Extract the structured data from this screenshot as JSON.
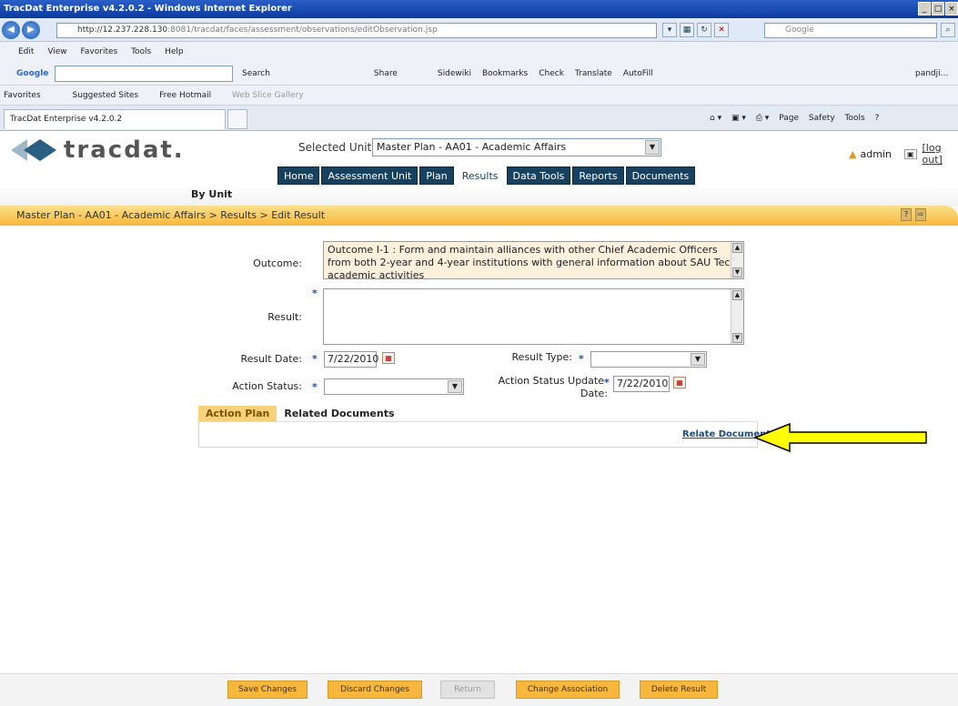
{
  "browser": {
    "title": "TracDat Enterprise v4.2.0.2 - Windows Internet Explorer",
    "url_host": "http://12.237.228.130",
    "url_path": ":8081/tracdat/faces/assessment/observations/editObservation.jsp",
    "search_placeholder": "Google",
    "menu": [
      "Edit",
      "View",
      "Favorites",
      "Tools",
      "Help"
    ],
    "google_label": "Google",
    "toolbar_items": [
      "Search",
      "Share",
      "Sidewiki",
      "Bookmarks",
      "Check",
      "Translate",
      "AutoFill",
      "pandji..."
    ],
    "favorites_label": "Favorites",
    "fav_items": [
      "Suggested Sites",
      "Free Hotmail",
      "Web Slice Gallery"
    ],
    "tab_title": "TracDat Enterprise v4.2.0.2",
    "commands": [
      "Page",
      "Safety",
      "Tools"
    ]
  },
  "app": {
    "logo_text": "tracdat.",
    "selected_unit_label": "Selected Unit:",
    "selected_unit_value": "Master Plan - AA01 - Academic Affairs",
    "user": "admin",
    "logout": "[log out]",
    "nav_tabs": [
      "Home",
      "Assessment Unit",
      "Plan",
      "Results",
      "Data Tools",
      "Reports",
      "Documents"
    ],
    "active_tab": "Results",
    "subnav": "By Unit",
    "breadcrumb": "Master Plan - AA01 - Academic Affairs > Results > Edit Result"
  },
  "form": {
    "outcome_label": "Outcome:",
    "outcome_text": "Outcome I-1 : Form and maintain alliances with other Chief Academic Officers from both 2-year and 4-year institutions with general information about SAU Tech academic activities",
    "result_label": "Result:",
    "result_value": "",
    "result_date_label": "Result Date:",
    "result_date_value": "7/22/2010",
    "result_type_label": "Result Type:",
    "result_type_value": "",
    "action_status_label": "Action Status:",
    "action_status_value": "",
    "action_status_update_label_1": "Action Status Update",
    "action_status_update_label_2": "Date:",
    "action_status_update_value": "7/22/2010",
    "required_mark": "*"
  },
  "panel": {
    "tabs": [
      "Action Plan",
      "Related Documents"
    ],
    "active_tab": "Action Plan",
    "relate_link": "Relate Document"
  },
  "footer_buttons": [
    "Save Changes",
    "Discard Changes",
    "Return",
    "Change Association",
    "Delete Result"
  ],
  "colors": {
    "nav": "#17415f",
    "accent": "#f6b73c",
    "arrow": "#ffff00"
  }
}
